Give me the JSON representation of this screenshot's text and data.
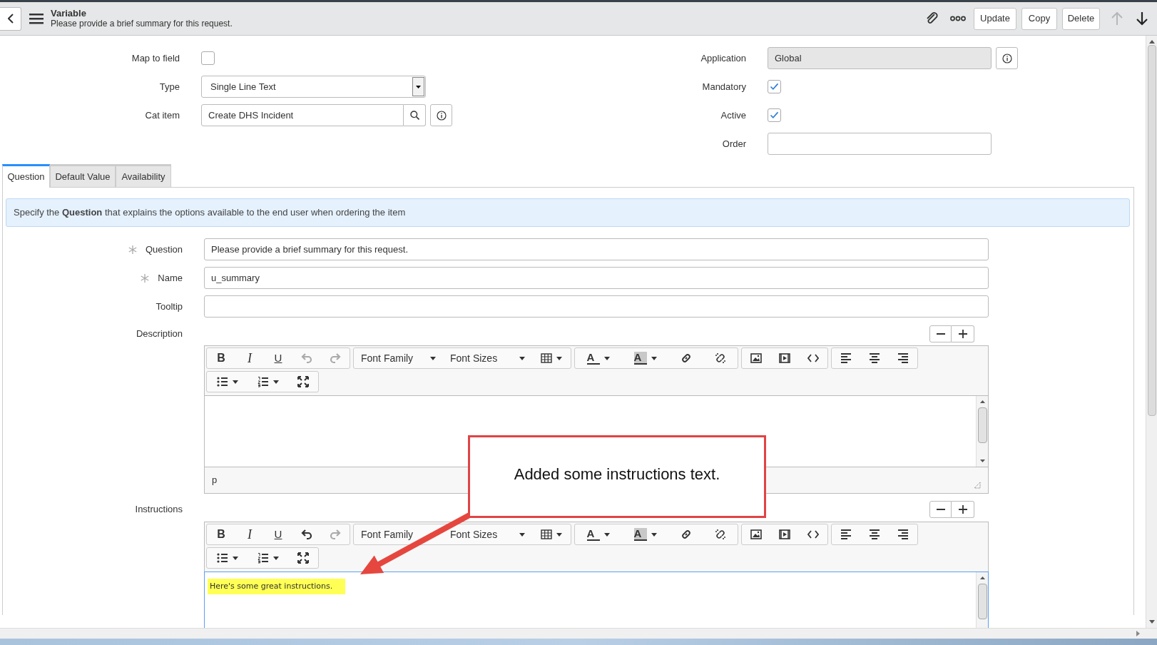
{
  "header": {
    "title": "Variable",
    "subtitle": "Please provide a brief summary for this request.",
    "buttons": [
      "Update",
      "Copy",
      "Delete"
    ]
  },
  "fields_left": [
    {
      "kind": "checkbox",
      "label": "Map to field",
      "checked": false
    },
    {
      "kind": "select",
      "label": "Type",
      "value": "Single Line Text"
    },
    {
      "kind": "reference",
      "label": "Cat item",
      "value": "Create DHS Incident"
    }
  ],
  "fields_right": [
    {
      "kind": "readonly",
      "label": "Application",
      "value": "Global"
    },
    {
      "kind": "checkbox",
      "label": "Mandatory",
      "checked": true
    },
    {
      "kind": "checkbox",
      "label": "Active",
      "checked": true
    },
    {
      "kind": "text",
      "label": "Order"
    }
  ],
  "tabs": [
    {
      "label": "Question",
      "selected": true
    },
    {
      "label": "Default Value",
      "selected": false
    },
    {
      "label": "Availability",
      "selected": false
    }
  ],
  "info_banner": "Specify the **Question** that explains the options available to the end user when ordering the item",
  "question_fields": [
    {
      "label": "Question",
      "mandatory": true,
      "value": "Please provide a brief summary for this request."
    },
    {
      "label": "Name",
      "mandatory": true,
      "value": "u_summary"
    },
    {
      "label": "Tooltip",
      "mandatory": false
    }
  ],
  "editors": [
    {
      "label": "Description",
      "toolbar": {
        "format": [
          "B",
          "I",
          "U"
        ],
        "font_family": "Font Family",
        "font_sizes": "Font Sizes",
        "color_letters": [
          "A",
          "A"
        ]
      },
      "undo_enabled": false,
      "focused": false,
      "status_path": "p"
    },
    {
      "label": "Instructions",
      "toolbar": {
        "format": [
          "B",
          "I",
          "U"
        ],
        "font_family": "Font Family",
        "font_sizes": "Font Sizes",
        "color_letters": [
          "A",
          "A"
        ]
      },
      "undo_enabled": true,
      "focused": true,
      "content": "Here's some great instructions.",
      "highlighted": true
    }
  ],
  "callout": {
    "text": "Added some instructions text."
  }
}
